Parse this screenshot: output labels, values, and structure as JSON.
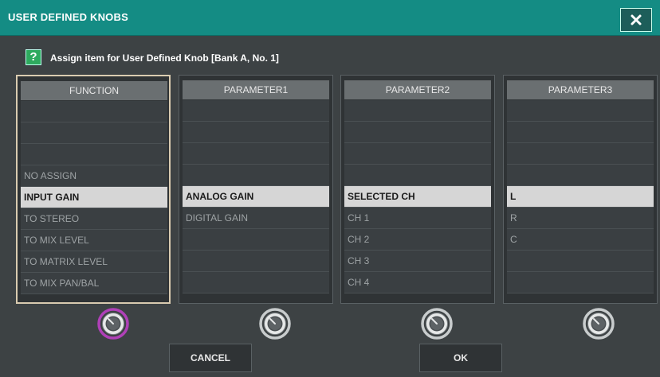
{
  "window": {
    "title": "USER DEFINED KNOBS"
  },
  "prompt": "Assign item for User Defined Knob [Bank A, No. 1]",
  "help_glyph": "?",
  "icons": {
    "close": "close-icon",
    "help": "help-icon",
    "knob": "knob-icon"
  },
  "colors": {
    "titlebar": "#148c84",
    "help": "#2eaa5e",
    "knob_active": "#b040b8",
    "selected_row": "#d6d6d6"
  },
  "columns": [
    {
      "header": "FUNCTION",
      "active": true,
      "rows": [
        "",
        "",
        "",
        "NO ASSIGN",
        "INPUT GAIN",
        "TO STEREO",
        "TO MIX LEVEL",
        "TO MATRIX LEVEL",
        "TO MIX PAN/BAL"
      ],
      "selected": 4
    },
    {
      "header": "PARAMETER1",
      "active": false,
      "rows": [
        "",
        "",
        "",
        "",
        "ANALOG GAIN",
        "DIGITAL GAIN",
        "",
        "",
        ""
      ],
      "selected": 4
    },
    {
      "header": "PARAMETER2",
      "active": false,
      "rows": [
        "",
        "",
        "",
        "",
        "SELECTED CH",
        "CH 1",
        "CH 2",
        "CH 3",
        "CH 4"
      ],
      "selected": 4
    },
    {
      "header": "PARAMETER3",
      "active": false,
      "rows": [
        "",
        "",
        "",
        "",
        "L",
        "R",
        "C",
        "",
        ""
      ],
      "selected": 4
    }
  ],
  "buttons": {
    "cancel": "CANCEL",
    "ok": "OK"
  }
}
